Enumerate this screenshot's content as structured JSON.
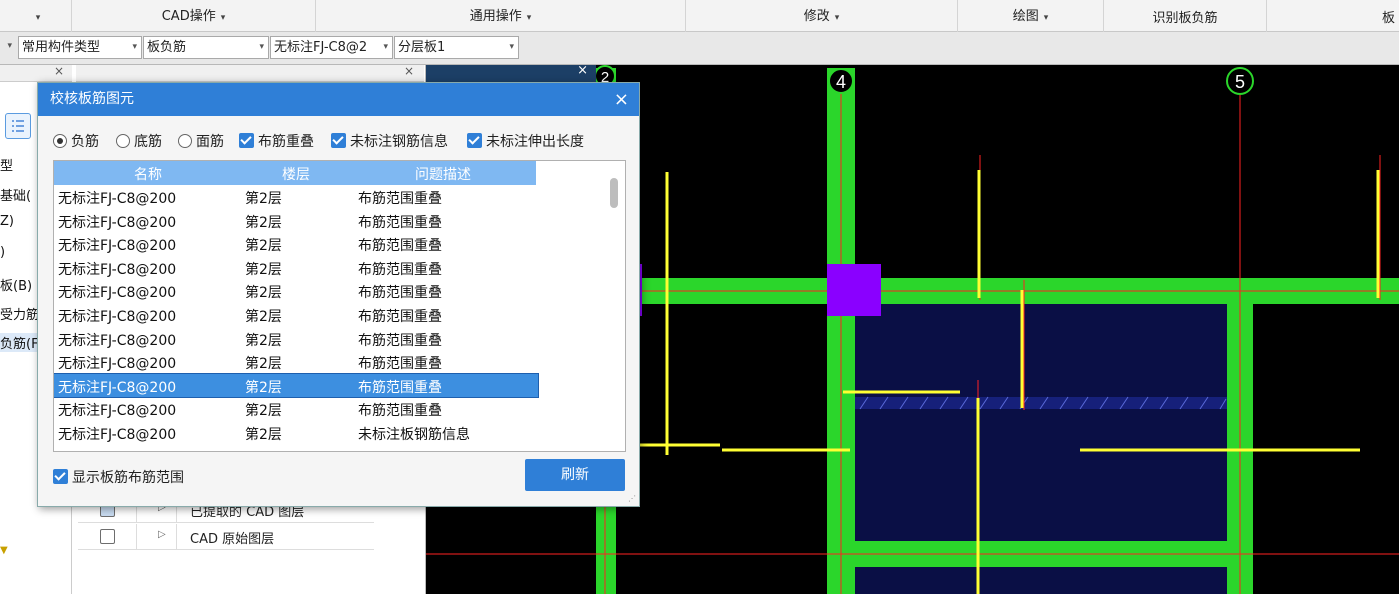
{
  "ribbon": {
    "groups": [
      {
        "label": "",
        "arrow": "▾"
      },
      {
        "label": "CAD操作",
        "arrow": "▾"
      },
      {
        "label": "通用操作",
        "arrow": "▾"
      },
      {
        "label": "修改",
        "arrow": "▾"
      },
      {
        "label": "绘图",
        "arrow": "▾"
      },
      {
        "label": "识别板负筋",
        "arrow": ""
      },
      {
        "label": "板",
        "arrow": ""
      }
    ]
  },
  "toolbar": {
    "combo0": "",
    "combo1": "常用构件类型",
    "combo2": "板负筋",
    "combo3": "无标注FJ-C8@2",
    "combo4": "分层板1"
  },
  "left_panel": {
    "items": [
      "型",
      "基础(",
      "Z)",
      ")",
      "板(B)",
      "受力筋(",
      "负筋(F)"
    ]
  },
  "layers": {
    "rows": [
      {
        "label": "已提取的 CAD 图层"
      },
      {
        "label": "CAD 原始图层"
      }
    ]
  },
  "canvas": {
    "axis_labels": [
      "2",
      "4",
      "5"
    ],
    "colors": {
      "beam": "#2bd62b",
      "slab": "#0a0f45",
      "rebar": "#ffff33",
      "axis": "#ff2222",
      "column": "#8a00ff"
    }
  },
  "dialog": {
    "title": "校核板筋图元",
    "close": "×",
    "options": {
      "radio_neg": "负筋",
      "radio_bottom": "底筋",
      "radio_face": "面筋",
      "chk_overlap": "布筋重叠",
      "chk_unlabeled_info": "未标注钢筋信息",
      "chk_unlabeled_len": "未标注伸出长度"
    },
    "table": {
      "headers": [
        "名称",
        "楼层",
        "问题描述"
      ],
      "rows": [
        [
          "无标注FJ-C8@200",
          "第2层",
          "布筋范围重叠"
        ],
        [
          "无标注FJ-C8@200",
          "第2层",
          "布筋范围重叠"
        ],
        [
          "无标注FJ-C8@200",
          "第2层",
          "布筋范围重叠"
        ],
        [
          "无标注FJ-C8@200",
          "第2层",
          "布筋范围重叠"
        ],
        [
          "无标注FJ-C8@200",
          "第2层",
          "布筋范围重叠"
        ],
        [
          "无标注FJ-C8@200",
          "第2层",
          "布筋范围重叠"
        ],
        [
          "无标注FJ-C8@200",
          "第2层",
          "布筋范围重叠"
        ],
        [
          "无标注FJ-C8@200",
          "第2层",
          "布筋范围重叠"
        ],
        [
          "无标注FJ-C8@200",
          "第2层",
          "布筋范围重叠"
        ],
        [
          "无标注FJ-C8@200",
          "第2层",
          "布筋范围重叠"
        ],
        [
          "无标注FJ-C8@200",
          "第2层",
          "未标注板钢筋信息"
        ]
      ],
      "selected_index": 8
    },
    "show_range": "显示板筋布筋范围",
    "refresh": "刷新"
  }
}
